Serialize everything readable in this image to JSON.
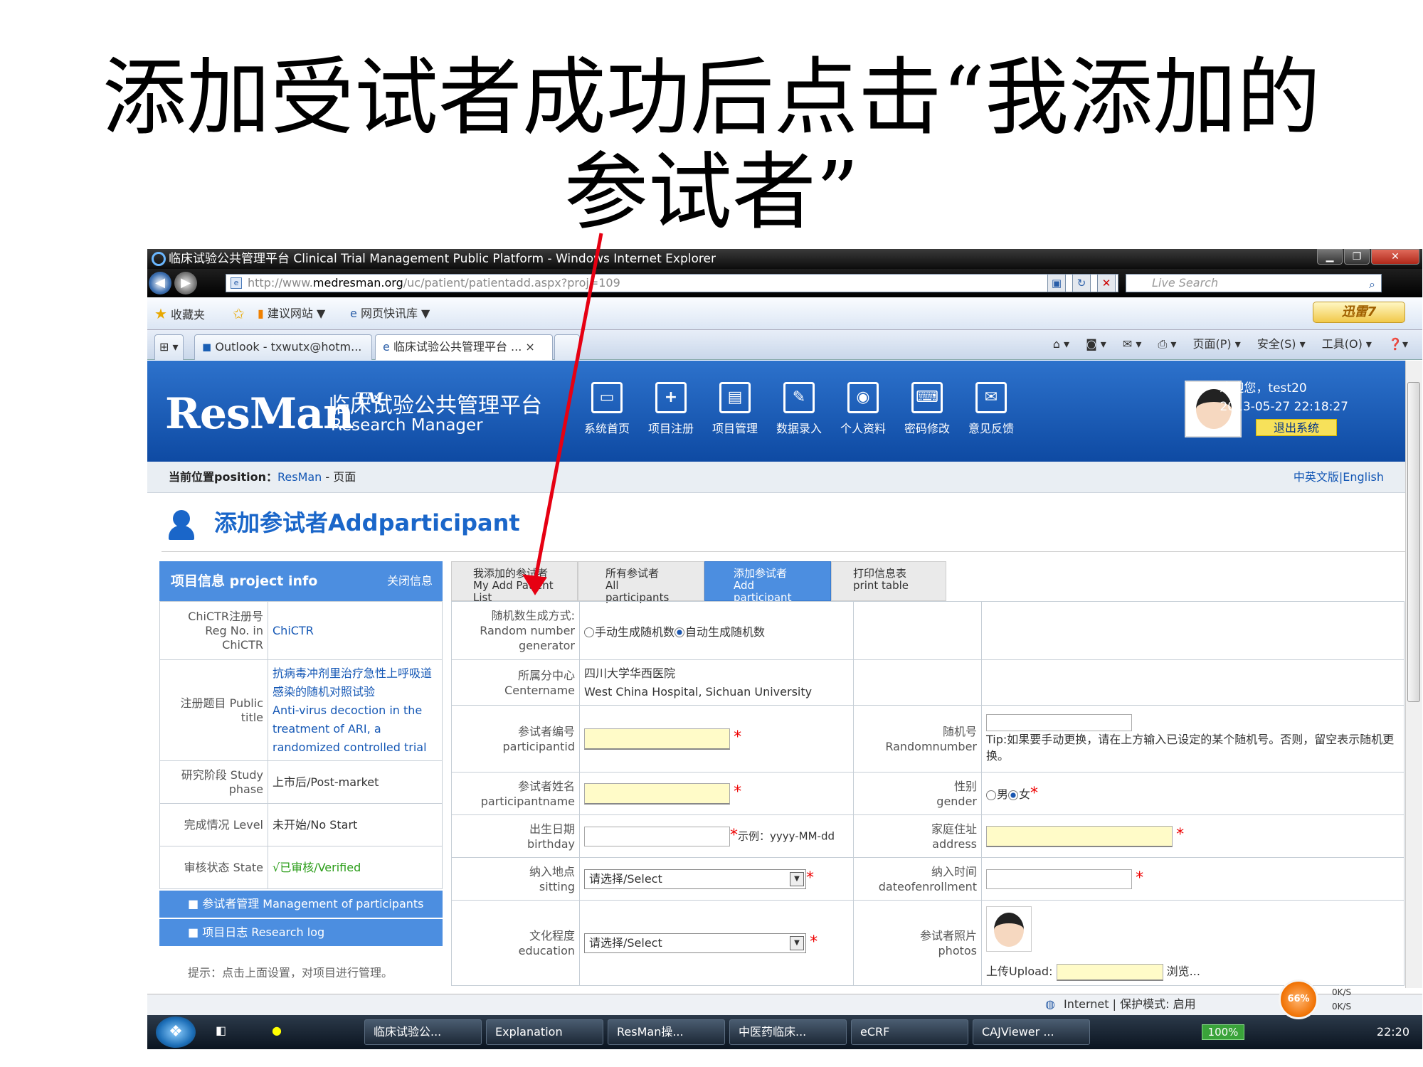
{
  "slide": {
    "title_line1": "添加受试者成功后点击“我添加的",
    "title_line2": "参试者”"
  },
  "window": {
    "title": "临床试验公共管理平台 Clinical Trial Management Public Platform - Windows Internet Explorer"
  },
  "browser": {
    "url_prefix": "http://www.",
    "url_domain": "medresman.org",
    "url_path": "/uc/patient/patientadd.aspx?proj=109",
    "search_placeholder": "Live Search",
    "favorites": "收藏夹",
    "suggested": "建议网站 ▼",
    "webslice": "网页快讯库 ▼",
    "xunlei": "迅雷7",
    "tabs": [
      "Outlook - txwutx@hotm...",
      "临床试验公共管理平台 ... ×"
    ],
    "commands": [
      "页面(P) ▾",
      "安全(S) ▾",
      "工具(O) ▾"
    ]
  },
  "site": {
    "logo": "ResMan",
    "tm": "TM",
    "platform": "临床试验公共管理平台",
    "subtitle": "Research Manager",
    "nav": [
      {
        "label": "系统首页",
        "icon": "monitor-icon"
      },
      {
        "label": "项目注册",
        "icon": "doc-add-icon"
      },
      {
        "label": "项目管理",
        "icon": "doc-lock-icon"
      },
      {
        "label": "数据录入",
        "icon": "edit-icon"
      },
      {
        "label": "个人资料",
        "icon": "shield-user-icon"
      },
      {
        "label": "密码修改",
        "icon": "keyboard-icon"
      },
      {
        "label": "意见反馈",
        "icon": "feedback-icon"
      }
    ],
    "welcome": "欢迎您，test20",
    "datetime": "2013-05-27 22:18:27",
    "logout": "退出系统"
  },
  "breadcrumb": {
    "label": "当前位置position：",
    "link": "ResMan",
    "rest": " - 页面",
    "lang": "中英文版|English"
  },
  "page_title": "添加参试者Addparticipant",
  "project_info": {
    "header": "项目信息 project info",
    "close": "关闭信息",
    "rows": [
      {
        "label": "ChiCTR注册号 Reg No. in ChiCTR",
        "value": "ChiCTR"
      },
      {
        "label": "注册题目 Public title",
        "value_cn": "抗病毒冲剂里治疗急性上呼吸道感染的随机对照试验",
        "value_en": "Anti-virus decoction in the treatment of ARI, a randomized controlled trial"
      },
      {
        "label": "研究阶段 Study phase",
        "value": "上市后/Post-market"
      },
      {
        "label": "完成情况 Level",
        "value": "未开始/No Start"
      },
      {
        "label": "审核状态 State",
        "value": "√已审核/Verified"
      }
    ],
    "menu": [
      "■ 参试者管理 Management of participants",
      "■ 项目日志 Research log"
    ],
    "tip": "提示：点击上面设置，对项目进行管理。"
  },
  "tabs": [
    {
      "cn": "我添加的参试者",
      "en": "My Add Patient List"
    },
    {
      "cn": "所有参试者",
      "en": "All participants"
    },
    {
      "cn": "添加参试者",
      "en": "Add participant"
    },
    {
      "cn": "打印信息表",
      "en": "print table"
    }
  ],
  "form": {
    "random_label_cn": "随机数生成方式:",
    "random_label_en": "Random number generator",
    "random_opt1": "手动生成随机数",
    "random_opt2": "自动生成随机数",
    "center_label_cn": "所属分中心",
    "center_label_en": "Centername",
    "center_cn": "四川大学华西医院",
    "center_en": "West China Hospital, Sichuan University",
    "pid_label_cn": "参试者编号",
    "pid_label_en": "participantid",
    "randno_label_cn": "随机号",
    "randno_label_en": "Randomnumber",
    "randno_tip": "Tip:如果要手动更换，请在上方输入已设定的某个随机号。否则，留空表示随机更换。",
    "pname_label_cn": "参试者姓名",
    "pname_label_en": "participantname",
    "gender_label_cn": "性别",
    "gender_label_en": "gender",
    "male": "男",
    "female": "女",
    "birth_label_cn": "出生日期",
    "birth_label_en": "birthday",
    "birth_example": "示例：yyyy-MM-dd",
    "addr_label_cn": "家庭住址",
    "addr_label_en": "address",
    "site_label_cn": "纳入地点",
    "site_label_en": "sitting",
    "select": "请选择/Select",
    "date_label_cn": "纳入时间",
    "date_label_en": "dateofenrollment",
    "edu_label_cn": "文化程度",
    "edu_label_en": "education",
    "photo_label_cn": "参试者照片",
    "photo_label_en": "photos",
    "upload": "上传Upload:",
    "browse": "浏览..."
  },
  "statusbar": {
    "zone": "Internet | 保护模式: 启用",
    "gauge": "66%",
    "up": "0K/S",
    "down": "0K/S"
  },
  "taskbar": {
    "items": [
      "临床试验公...",
      "Explanation",
      "ResMan操...",
      "中医药临床...",
      "eCRF",
      "CAJViewer ..."
    ],
    "percent": "100%",
    "time": "22:20"
  }
}
